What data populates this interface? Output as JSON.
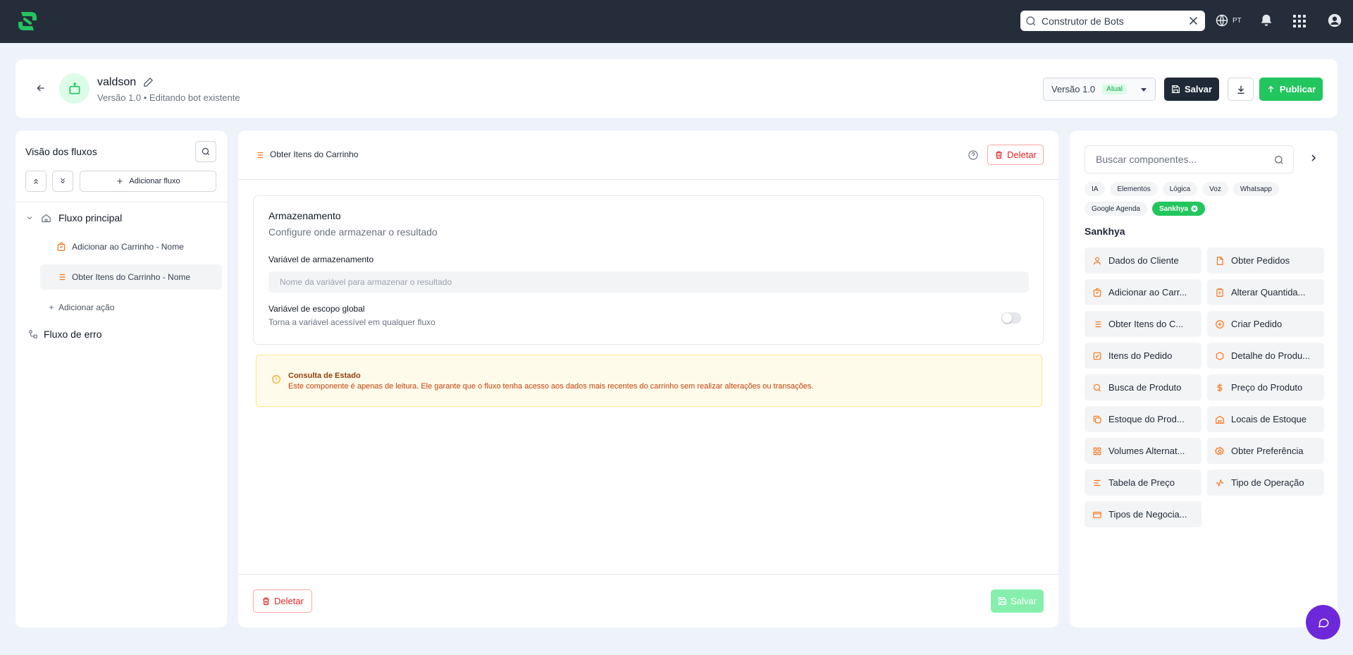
{
  "topbar": {
    "search_value": "Construtor de Bots",
    "lang": "PT"
  },
  "header": {
    "bot_name": "valdson",
    "subtitle": "Versão 1.0 • Editando bot existente",
    "version_label": "Versão 1.0",
    "version_badge": "Atual",
    "save_label": "Salvar",
    "publish_label": "Publicar"
  },
  "flows": {
    "title": "Visão dos fluxos",
    "add_flow_label": "Adicionar fluxo",
    "main_flow": "Fluxo principal",
    "actions": [
      {
        "label": "Adicionar ao Carrinho - Nome",
        "icon": "shopping-bag-icon"
      },
      {
        "label": "Obter Itens do Carrinho - Nome",
        "icon": "list-icon"
      }
    ],
    "add_action_label": "Adicionar ação",
    "error_flow": "Fluxo de erro"
  },
  "editor": {
    "title": "Obter Itens do Carrinho",
    "delete_label": "Deletar",
    "storage_title": "Armazenamento",
    "storage_subtitle": "Configure onde armazenar o resultado",
    "var_label": "Variável de armazenamento",
    "var_placeholder": "Nome da variável para armazenar o resultado",
    "global_label": "Variável de escopo global",
    "global_sub": "Torna a variável acessível em qualquer fluxo",
    "notice_title": "Consulta de Estado",
    "notice_text": "Este componente é apenas de leitura. Ele garante que o fluxo tenha acesso aos dados mais recentes do carrinho sem realizar alterações ou transações.",
    "footer_delete": "Deletar",
    "footer_save": "Salvar"
  },
  "components": {
    "search_placeholder": "Buscar componentes...",
    "chips": [
      {
        "label": "IA",
        "active": false
      },
      {
        "label": "Elementos",
        "active": false
      },
      {
        "label": "Lógica",
        "active": false
      },
      {
        "label": "Voz",
        "active": false
      },
      {
        "label": "Whatsapp",
        "active": false
      },
      {
        "label": "Google Agenda",
        "active": false
      },
      {
        "label": "Sankhya",
        "active": true
      }
    ],
    "section": "Sankhya",
    "items": [
      {
        "label": "Dados do Cliente",
        "icon": "user-icon"
      },
      {
        "label": "Obter Pedidos",
        "icon": "file-icon"
      },
      {
        "label": "Adicionar ao Carr...",
        "icon": "shopping-bag-icon"
      },
      {
        "label": "Alterar Quantida...",
        "icon": "clipboard-icon"
      },
      {
        "label": "Obter Itens do C...",
        "icon": "list-icon"
      },
      {
        "label": "Criar Pedido",
        "icon": "plus-circle-icon"
      },
      {
        "label": "Itens do Pedido",
        "icon": "check-square-icon"
      },
      {
        "label": "Detalhe do Produ...",
        "icon": "box-icon"
      },
      {
        "label": "Busca de Produto",
        "icon": "search-icon"
      },
      {
        "label": "Preço do Produto",
        "icon": "dollar-icon"
      },
      {
        "label": "Estoque do Prod...",
        "icon": "copy-icon"
      },
      {
        "label": "Locais de Estoque",
        "icon": "warehouse-icon"
      },
      {
        "label": "Volumes Alternat...",
        "icon": "grid-icon"
      },
      {
        "label": "Obter Preferência",
        "icon": "settings-icon"
      },
      {
        "label": "Tabela de Preço",
        "icon": "align-left-icon"
      },
      {
        "label": "Tipo de Operação",
        "icon": "activity-icon"
      },
      {
        "label": "Tipos de Negocia...",
        "icon": "credit-card-icon"
      }
    ]
  },
  "colors": {
    "accent_orange": "#f97316",
    "brand_green": "#22c55e",
    "danger": "#dc2626",
    "topbar": "#252d3b"
  }
}
